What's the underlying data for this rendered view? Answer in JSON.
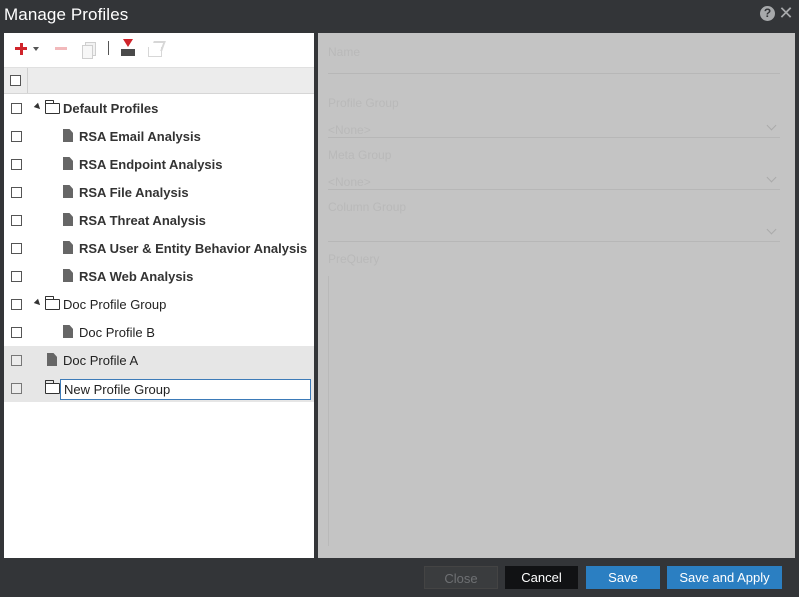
{
  "window": {
    "title": "Manage Profiles"
  },
  "icons": {
    "help": "question-mark-icon",
    "close": "close-x-icon",
    "add": "plus-icon",
    "remove": "minus-icon",
    "copy": "copy-icon",
    "import": "import-icon",
    "share": "export-share-icon",
    "folder": "folder-icon",
    "document": "document-icon"
  },
  "title_bar": {
    "help_glyph": "?",
    "close_glyph": "✕"
  },
  "tree": {
    "rows": [
      {
        "label": "Default Profiles",
        "type": "group",
        "bold": true
      },
      {
        "label": "RSA Email Analysis",
        "type": "profile",
        "bold": true
      },
      {
        "label": "RSA Endpoint Analysis",
        "type": "profile",
        "bold": true
      },
      {
        "label": "RSA File Analysis",
        "type": "profile",
        "bold": true
      },
      {
        "label": "RSA Threat Analysis",
        "type": "profile",
        "bold": true
      },
      {
        "label": "RSA User & Entity Behavior Analysis",
        "type": "profile",
        "bold": true
      },
      {
        "label": "RSA Web Analysis",
        "type": "profile",
        "bold": true
      },
      {
        "label": "Doc Profile Group",
        "type": "group",
        "bold": false
      },
      {
        "label": "Doc Profile B",
        "type": "profile",
        "bold": false
      },
      {
        "label": "Doc Profile A",
        "type": "profile",
        "bold": false,
        "selected": true
      },
      {
        "label": "",
        "type": "group",
        "bold": false,
        "selected": true,
        "editing": true
      }
    ],
    "new_group_input_value": "New Profile Group"
  },
  "details": {
    "name_label": "Name",
    "profile_group_label": "Profile Group",
    "profile_group_value": "<None>",
    "meta_group_label": "Meta Group",
    "meta_group_value": "<None>",
    "column_group_label": "Column Group",
    "prequery_label": "PreQuery"
  },
  "footer": {
    "close_label": "Close",
    "cancel_label": "Cancel",
    "save_label": "Save",
    "save_apply_label": "Save and Apply"
  },
  "colors": {
    "dialog_bg": "#333538",
    "panel_bg": "#ffffff",
    "disabled_panel_bg": "#c4c4c4",
    "primary_button": "#2b7fc2",
    "add_icon": "#d0242b"
  }
}
